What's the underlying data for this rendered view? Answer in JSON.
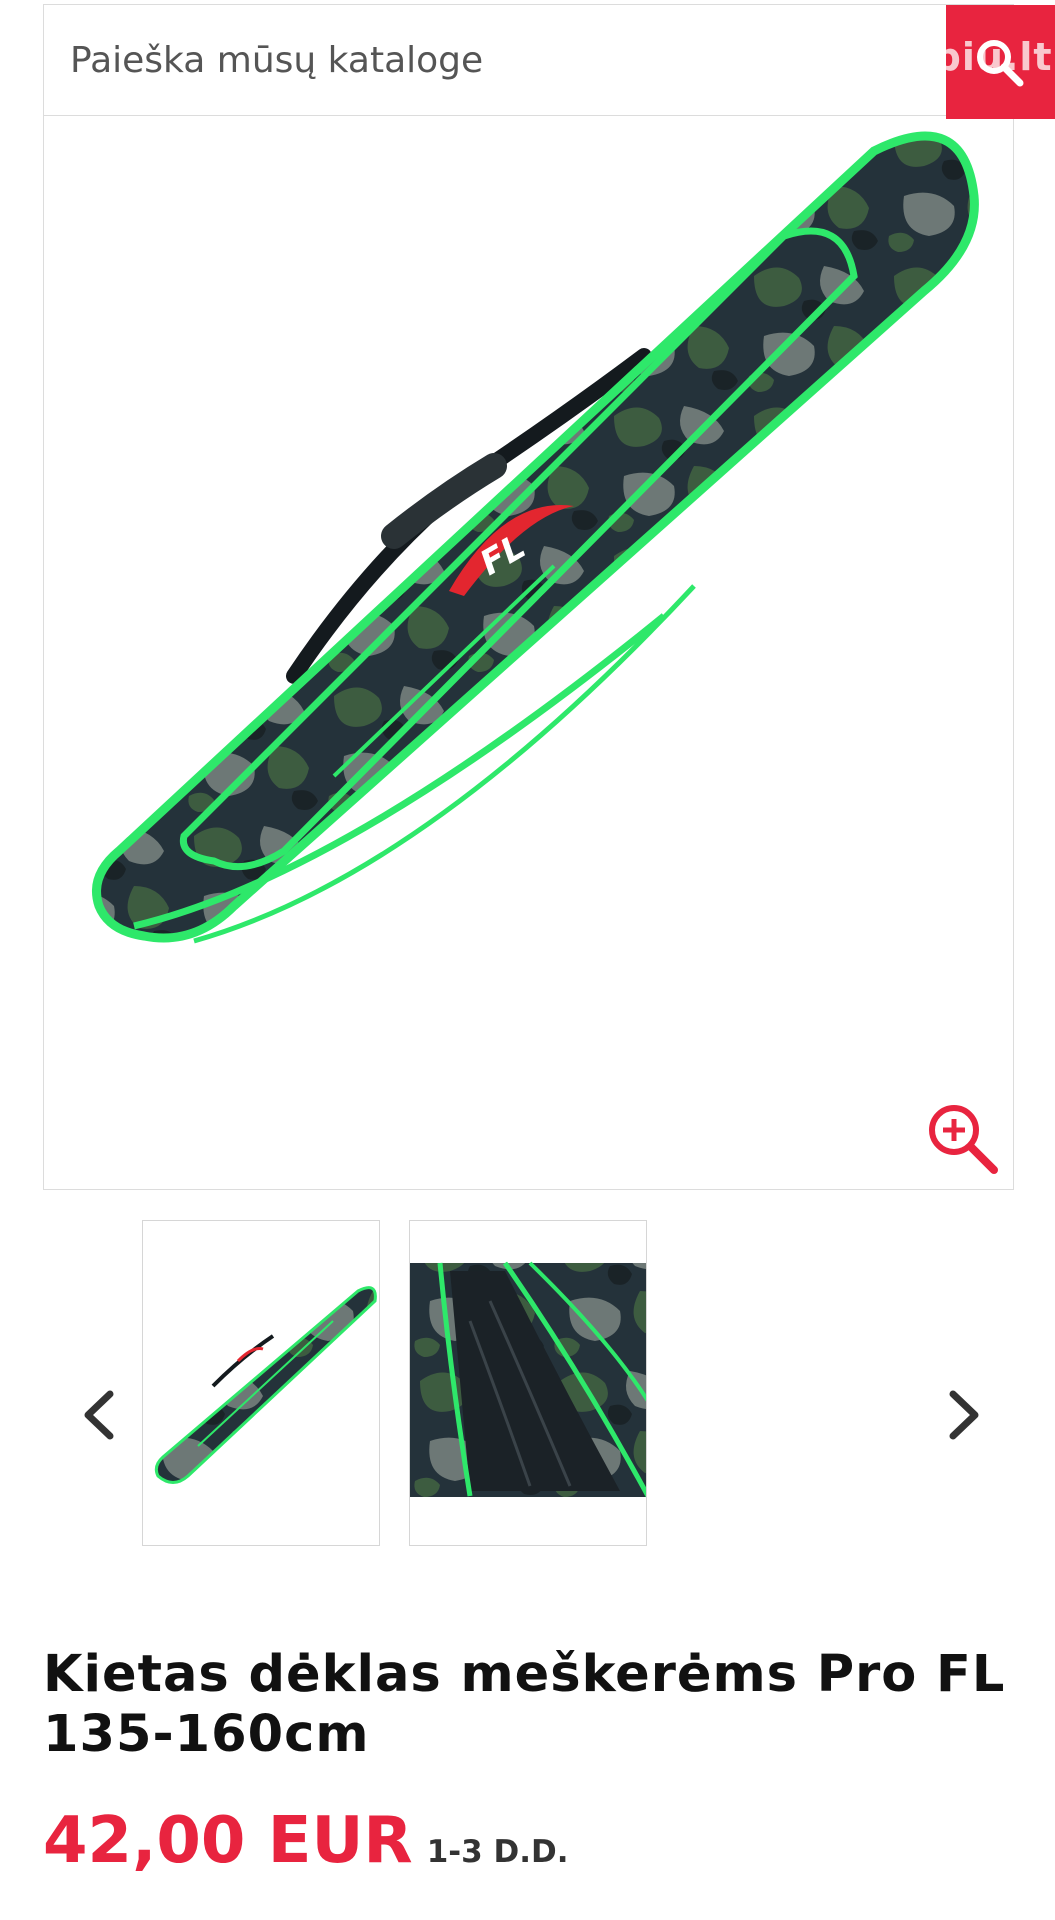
{
  "search": {
    "placeholder": "Paieška mūsų kataloge",
    "watermark": "skelbiu.lt"
  },
  "product": {
    "title": "Kietas dėklas meškerėms Pro FL 135-160cm",
    "logo_text": "FL",
    "price": "42,00 EUR",
    "delivery": "1-3 D.D."
  },
  "icons": {
    "search": "search-icon",
    "zoom": "zoom-in-icon",
    "prev": "chevron-left-icon",
    "next": "chevron-right-icon"
  },
  "colors": {
    "accent": "#e8243f",
    "bag_green": "#2ee86a",
    "camo_dark": "#1f2a2e",
    "camo_mid": "#3a5a3e",
    "camo_light": "#6f7a78",
    "text": "#111111"
  }
}
